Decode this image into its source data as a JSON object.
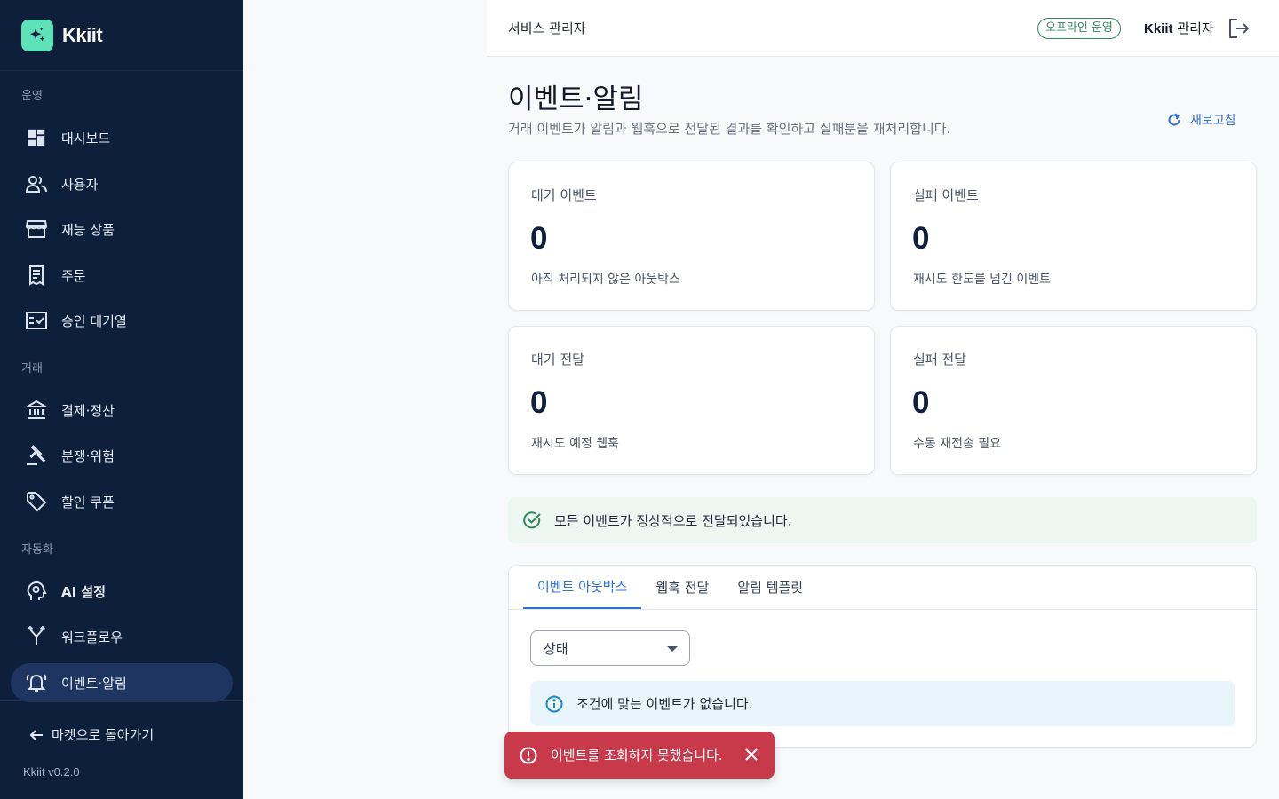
{
  "brand": {
    "name": "Kkiit",
    "logo_icon": "sparkle-icon",
    "accent": "#5ee3b9"
  },
  "sidebar": {
    "sections": [
      {
        "title": "운영"
      },
      {
        "title": "거래"
      },
      {
        "title": "자동화"
      }
    ],
    "items": [
      {
        "label": "대시보드",
        "icon": "dashboard-icon"
      },
      {
        "label": "사용자",
        "icon": "users-icon"
      },
      {
        "label": "재능 상품",
        "icon": "store-icon"
      },
      {
        "label": "주문",
        "icon": "receipt-icon"
      },
      {
        "label": "승인 대기열",
        "icon": "checklist-icon"
      },
      {
        "label": "결제·정산",
        "icon": "bank-icon"
      },
      {
        "label": "분쟁·위험",
        "icon": "gavel-icon"
      },
      {
        "label": "할인 쿠폰",
        "icon": "tag-icon"
      },
      {
        "label": "AI 설정",
        "icon": "ai-brain-icon"
      },
      {
        "label": "워크플로우",
        "icon": "workflow-icon"
      },
      {
        "label": "이벤트·알림",
        "icon": "bell-icon",
        "active": true
      }
    ],
    "back_link": "마켓으로 돌아가기",
    "version": "Kkiit v0.2.0"
  },
  "topbar": {
    "title": "서비스 관리자",
    "badge": "오프라인 운영",
    "admin_brand": "Kkiit",
    "admin_role": "관리자"
  },
  "page": {
    "title": "이벤트·알림",
    "description": "거래 이벤트가 알림과 웹훅으로 전달된 결과를 확인하고 실패분을 재처리합니다.",
    "refresh_label": "새로고침"
  },
  "stats": [
    {
      "label": "대기 이벤트",
      "value": "0",
      "sub": "아직 처리되지 않은 아웃박스"
    },
    {
      "label": "실패 이벤트",
      "value": "0",
      "sub": "재시도 한도를 넘긴 이벤트"
    },
    {
      "label": "대기 전달",
      "value": "0",
      "sub": "재시도 예정 웹훅"
    },
    {
      "label": "실패 전달",
      "value": "0",
      "sub": "수동 재전송 필요"
    }
  ],
  "success_alert": "모든 이벤트가 정상적으로 전달되었습니다.",
  "tabs": [
    {
      "label": "이벤트 아웃박스",
      "active": true
    },
    {
      "label": "웹훅 전달"
    },
    {
      "label": "알림 템플릿"
    }
  ],
  "filter": {
    "status_label": "상태"
  },
  "info_alert": "조건에 맞는 이벤트가 없습니다.",
  "toast": {
    "message": "이벤트를 조회하지 못했습니다.",
    "color": "#c8394a"
  }
}
